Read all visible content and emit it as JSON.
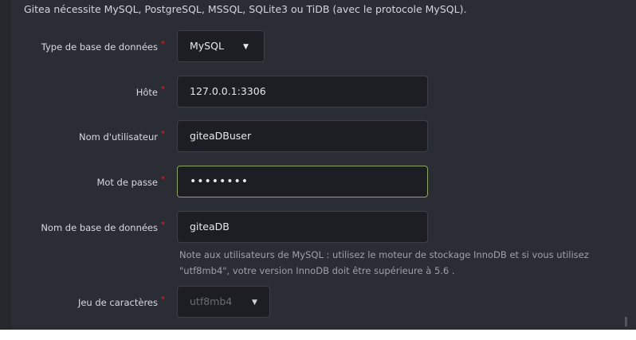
{
  "intro_text": "Gitea nécessite MySQL, PostgreSQL, MSSQL, SQLite3 ou TiDB (avec le protocole MySQL).",
  "required_mark": "*",
  "caret_icon": "▼",
  "fields": {
    "db_type": {
      "label": "Type de base de données",
      "value": "MySQL"
    },
    "host": {
      "label": "Hôte",
      "value": "127.0.0.1:3306"
    },
    "username": {
      "label": "Nom d'utilisateur",
      "value": "giteaDBuser"
    },
    "password": {
      "label": "Mot de passe",
      "value": "••••••••"
    },
    "db_name": {
      "label": "Nom de base de données",
      "value": "giteaDB"
    },
    "charset": {
      "label": "Jeu de caractères",
      "value": "utf8mb4"
    }
  },
  "db_name_note": "Note aux utilisateurs de MySQL : utilisez le moteur de stockage InnoDB et si vous utilisez \"utf8mb4\", votre version InnoDB doit être supérieure à 5.6 .",
  "colors": {
    "panel_bg": "#2b2d34",
    "input_bg": "#1c1e23",
    "required": "#db2828",
    "focus_border": "#8da566"
  }
}
